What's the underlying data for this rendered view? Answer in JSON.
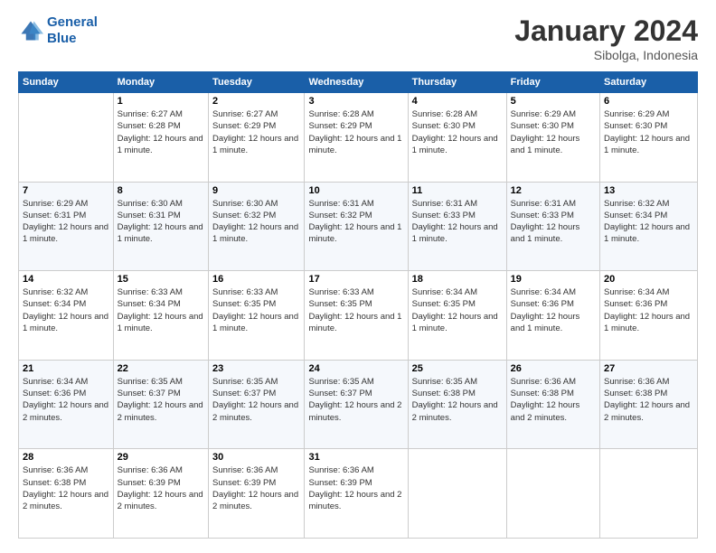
{
  "logo": {
    "line1": "General",
    "line2": "Blue"
  },
  "title": "January 2024",
  "subtitle": "Sibolga, Indonesia",
  "days_of_week": [
    "Sunday",
    "Monday",
    "Tuesday",
    "Wednesday",
    "Thursday",
    "Friday",
    "Saturday"
  ],
  "weeks": [
    [
      {
        "day": "",
        "info": ""
      },
      {
        "day": "1",
        "info": "Sunrise: 6:27 AM\nSunset: 6:28 PM\nDaylight: 12 hours and 1 minute."
      },
      {
        "day": "2",
        "info": "Sunrise: 6:27 AM\nSunset: 6:29 PM\nDaylight: 12 hours and 1 minute."
      },
      {
        "day": "3",
        "info": "Sunrise: 6:28 AM\nSunset: 6:29 PM\nDaylight: 12 hours and 1 minute."
      },
      {
        "day": "4",
        "info": "Sunrise: 6:28 AM\nSunset: 6:30 PM\nDaylight: 12 hours and 1 minute."
      },
      {
        "day": "5",
        "info": "Sunrise: 6:29 AM\nSunset: 6:30 PM\nDaylight: 12 hours and 1 minute."
      },
      {
        "day": "6",
        "info": "Sunrise: 6:29 AM\nSunset: 6:30 PM\nDaylight: 12 hours and 1 minute."
      }
    ],
    [
      {
        "day": "7",
        "info": "Sunrise: 6:29 AM\nSunset: 6:31 PM\nDaylight: 12 hours and 1 minute."
      },
      {
        "day": "8",
        "info": "Sunrise: 6:30 AM\nSunset: 6:31 PM\nDaylight: 12 hours and 1 minute."
      },
      {
        "day": "9",
        "info": "Sunrise: 6:30 AM\nSunset: 6:32 PM\nDaylight: 12 hours and 1 minute."
      },
      {
        "day": "10",
        "info": "Sunrise: 6:31 AM\nSunset: 6:32 PM\nDaylight: 12 hours and 1 minute."
      },
      {
        "day": "11",
        "info": "Sunrise: 6:31 AM\nSunset: 6:33 PM\nDaylight: 12 hours and 1 minute."
      },
      {
        "day": "12",
        "info": "Sunrise: 6:31 AM\nSunset: 6:33 PM\nDaylight: 12 hours and 1 minute."
      },
      {
        "day": "13",
        "info": "Sunrise: 6:32 AM\nSunset: 6:34 PM\nDaylight: 12 hours and 1 minute."
      }
    ],
    [
      {
        "day": "14",
        "info": "Sunrise: 6:32 AM\nSunset: 6:34 PM\nDaylight: 12 hours and 1 minute."
      },
      {
        "day": "15",
        "info": "Sunrise: 6:33 AM\nSunset: 6:34 PM\nDaylight: 12 hours and 1 minute."
      },
      {
        "day": "16",
        "info": "Sunrise: 6:33 AM\nSunset: 6:35 PM\nDaylight: 12 hours and 1 minute."
      },
      {
        "day": "17",
        "info": "Sunrise: 6:33 AM\nSunset: 6:35 PM\nDaylight: 12 hours and 1 minute."
      },
      {
        "day": "18",
        "info": "Sunrise: 6:34 AM\nSunset: 6:35 PM\nDaylight: 12 hours and 1 minute."
      },
      {
        "day": "19",
        "info": "Sunrise: 6:34 AM\nSunset: 6:36 PM\nDaylight: 12 hours and 1 minute."
      },
      {
        "day": "20",
        "info": "Sunrise: 6:34 AM\nSunset: 6:36 PM\nDaylight: 12 hours and 1 minute."
      }
    ],
    [
      {
        "day": "21",
        "info": "Sunrise: 6:34 AM\nSunset: 6:36 PM\nDaylight: 12 hours and 2 minutes."
      },
      {
        "day": "22",
        "info": "Sunrise: 6:35 AM\nSunset: 6:37 PM\nDaylight: 12 hours and 2 minutes."
      },
      {
        "day": "23",
        "info": "Sunrise: 6:35 AM\nSunset: 6:37 PM\nDaylight: 12 hours and 2 minutes."
      },
      {
        "day": "24",
        "info": "Sunrise: 6:35 AM\nSunset: 6:37 PM\nDaylight: 12 hours and 2 minutes."
      },
      {
        "day": "25",
        "info": "Sunrise: 6:35 AM\nSunset: 6:38 PM\nDaylight: 12 hours and 2 minutes."
      },
      {
        "day": "26",
        "info": "Sunrise: 6:36 AM\nSunset: 6:38 PM\nDaylight: 12 hours and 2 minutes."
      },
      {
        "day": "27",
        "info": "Sunrise: 6:36 AM\nSunset: 6:38 PM\nDaylight: 12 hours and 2 minutes."
      }
    ],
    [
      {
        "day": "28",
        "info": "Sunrise: 6:36 AM\nSunset: 6:38 PM\nDaylight: 12 hours and 2 minutes."
      },
      {
        "day": "29",
        "info": "Sunrise: 6:36 AM\nSunset: 6:39 PM\nDaylight: 12 hours and 2 minutes."
      },
      {
        "day": "30",
        "info": "Sunrise: 6:36 AM\nSunset: 6:39 PM\nDaylight: 12 hours and 2 minutes."
      },
      {
        "day": "31",
        "info": "Sunrise: 6:36 AM\nSunset: 6:39 PM\nDaylight: 12 hours and 2 minutes."
      },
      {
        "day": "",
        "info": ""
      },
      {
        "day": "",
        "info": ""
      },
      {
        "day": "",
        "info": ""
      }
    ]
  ]
}
